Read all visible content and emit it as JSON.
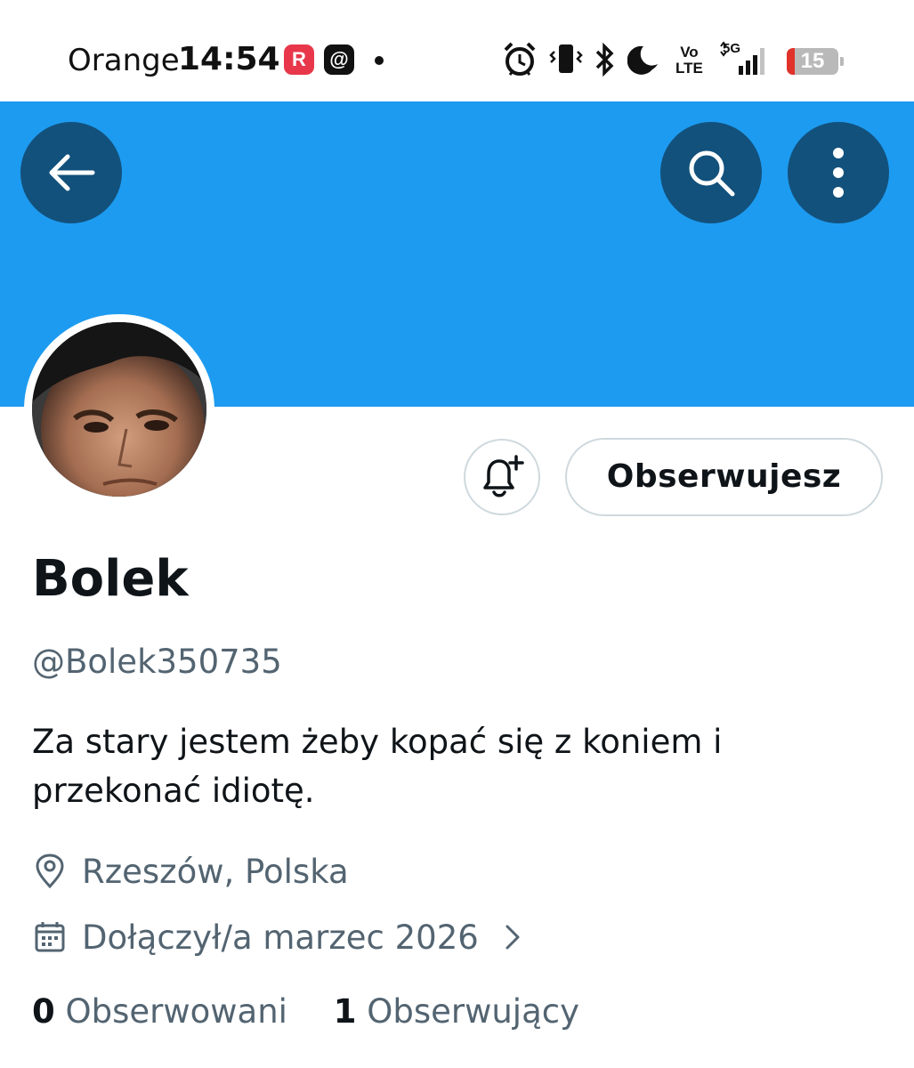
{
  "status_bar": {
    "carrier": "Orange",
    "time": "14:54",
    "app_icons": [
      "rakuten-icon",
      "threads-icon"
    ],
    "volte": [
      "Vo",
      "LTE"
    ],
    "network": "5G",
    "battery": "15"
  },
  "header": {
    "back_icon": "arrow-left-icon",
    "search_icon": "search-icon",
    "more_icon": "more-vertical-icon",
    "banner_color": "#1d9bf0",
    "button_color": "#12517c"
  },
  "profile": {
    "follow_button": "Obserwujesz",
    "name": "Bolek",
    "handle": "@Bolek350735",
    "bio": "Za stary jestem żeby kopać się z koniem i przekonać idiotę.",
    "location": "Rzeszów, Polska",
    "joined": "Dołączył/a marzec 2026",
    "following_count": "0",
    "following_label": "Obserwowani",
    "followers_count": "1",
    "followers_label": "Obserwujący"
  }
}
